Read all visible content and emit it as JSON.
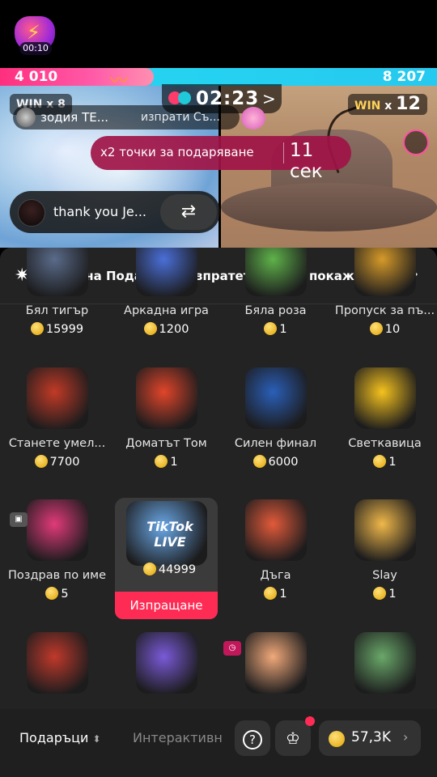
{
  "top": {
    "badge_timer": "00:10",
    "score_left": "4 010",
    "score_right": "8 207",
    "win_left": "WIN x 8",
    "win_right_label": "WIN",
    "win_right_x": "x",
    "win_right_count": "12",
    "battle_time": "02:23",
    "battle_chevron": ">"
  },
  "notice": {
    "name": "зодия ТЕ...",
    "action": "изпрати Съ..."
  },
  "bonus": {
    "text": "x2 точки за подаряване",
    "seconds": "11 сек"
  },
  "comment": {
    "text": "thank you Je...",
    "swap_icon": "⇄"
  },
  "banner": {
    "text": "яма на Подаръка. Изпратете, за да покажете",
    "chevron": "›"
  },
  "gifts": [
    {
      "name": "Бял тигър",
      "price": "15999",
      "icon": "tiger-icon",
      "color": "#5a6b8a"
    },
    {
      "name": "Аркадна игра",
      "price": "1200",
      "icon": "arcade-icon",
      "color": "#4a6fd8"
    },
    {
      "name": "Бяла роза",
      "price": "1",
      "icon": "rose-icon",
      "color": "#5fb24a"
    },
    {
      "name": "Пропуск за пъ...",
      "price": "10",
      "icon": "pass-icon",
      "color": "#d69a2a"
    },
    {
      "name": "Станете умел...",
      "price": "7700",
      "icon": "jeep-icon",
      "color": "#c23a26"
    },
    {
      "name": "Доматът Том",
      "price": "1",
      "icon": "tomato-icon",
      "color": "#e1452a"
    },
    {
      "name": "Силен финал",
      "price": "6000",
      "icon": "racecar-icon",
      "color": "#2a5fb8"
    },
    {
      "name": "Светкавица",
      "price": "1",
      "icon": "lightning-icon",
      "color": "#f5c21e"
    },
    {
      "name": "Поздрав по име",
      "price": "5",
      "icon": "mouth-icon",
      "color": "#e23a7a"
    },
    {
      "name": "TikTok LIVE",
      "price": "44999",
      "icon": "tiktok-live-icon",
      "color": "#6aa8e8"
    },
    {
      "name": "Дъга",
      "price": "1",
      "icon": "rainbow-icon",
      "color": "#e25a3a"
    },
    {
      "name": "Slay",
      "price": "1",
      "icon": "slay-icon",
      "color": "#f0b84a"
    },
    {
      "name": "",
      "price": "",
      "icon": "lion-rose-icon",
      "color": "#c0392b"
    },
    {
      "name": "",
      "price": "",
      "icon": "laptop-icon",
      "color": "#7a5ad8"
    },
    {
      "name": "",
      "price": "",
      "icon": "cake-icon",
      "color": "#f1a97a"
    },
    {
      "name": "",
      "price": "",
      "icon": "hippo-icon",
      "color": "#6aa86a"
    }
  ],
  "send_label": "Изпращане",
  "tiktok_live_logo": "TikTok LIVE",
  "bottom": {
    "tab_gifts": "Подаръци",
    "tab_interactive": "Интерактивни",
    "help_icon": "?",
    "wallet_amount": "57,3K"
  }
}
